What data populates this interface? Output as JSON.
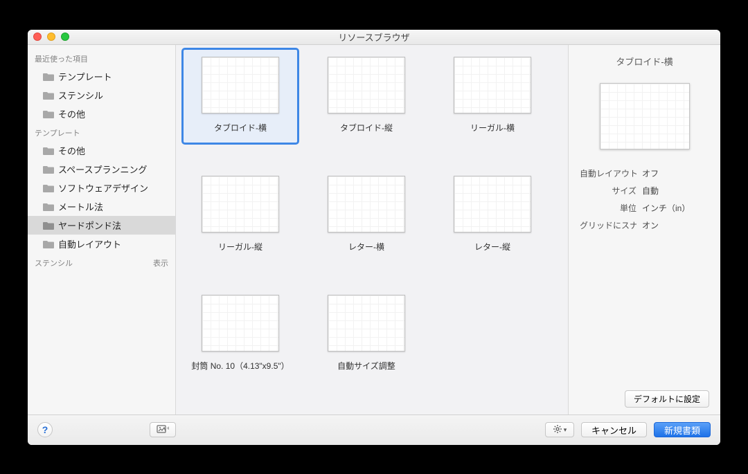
{
  "window": {
    "title": "リソースブラウザ"
  },
  "sidebar": {
    "sections": [
      {
        "header": "最近使った項目",
        "show_label": null,
        "items": [
          {
            "label": "テンプレート",
            "selected": false
          },
          {
            "label": "ステンシル",
            "selected": false
          },
          {
            "label": "その他",
            "selected": false
          }
        ]
      },
      {
        "header": "テンプレート",
        "show_label": null,
        "items": [
          {
            "label": "その他",
            "selected": false
          },
          {
            "label": "スペースプランニング",
            "selected": false
          },
          {
            "label": "ソフトウェアデザイン",
            "selected": false
          },
          {
            "label": "メートル法",
            "selected": false
          },
          {
            "label": "ヤードポンド法",
            "selected": true
          },
          {
            "label": "自動レイアウト",
            "selected": false
          }
        ]
      },
      {
        "header": "ステンシル",
        "show_label": "表示",
        "items": []
      }
    ]
  },
  "grid": {
    "items": [
      {
        "label": "タブロイド-横",
        "orientation": "landscape",
        "selected": true
      },
      {
        "label": "タブロイド-縦",
        "orientation": "landscape",
        "selected": false
      },
      {
        "label": "リーガル-横",
        "orientation": "landscape",
        "selected": false
      },
      {
        "label": "リーガル-縦",
        "orientation": "landscape",
        "selected": false
      },
      {
        "label": "レター-横",
        "orientation": "landscape",
        "selected": false
      },
      {
        "label": "レター-縦",
        "orientation": "landscape",
        "selected": false
      },
      {
        "label": "封筒 No. 10（4.13\"x9.5\"）",
        "orientation": "landscape",
        "selected": false
      },
      {
        "label": "自動サイズ調整",
        "orientation": "landscape",
        "selected": false
      }
    ]
  },
  "inspector": {
    "title": "タブロイド-横",
    "props": [
      {
        "k": "自動レイアウト",
        "v": "オフ"
      },
      {
        "k": "サイズ",
        "v": "自動"
      },
      {
        "k": "単位",
        "v": "インチ（in）"
      },
      {
        "k": "グリッドにスナップ",
        "v": "オン"
      }
    ],
    "default_btn": "デフォルトに設定"
  },
  "footer": {
    "help": "?",
    "import_icon": "⊞+",
    "gear_icon": "✱",
    "gear_chev": "▾",
    "cancel": "キャンセル",
    "create": "新規書類"
  }
}
